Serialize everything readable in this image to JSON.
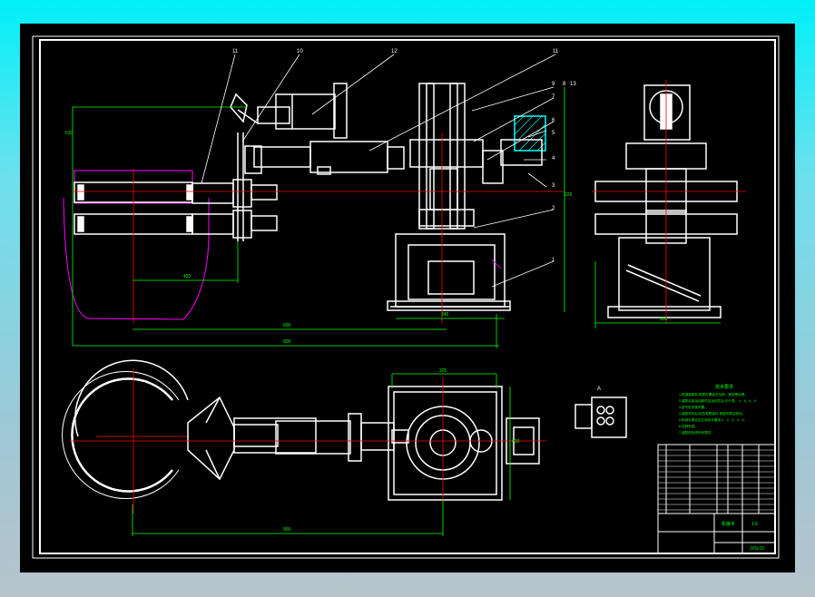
{
  "view": {
    "background_gradient": [
      "#00f0f8",
      "#b8c4cc"
    ],
    "canvas_color": "#000000"
  },
  "colors": {
    "outline": "#ffffff",
    "dimension": "#00ff00",
    "centerline": "#ff0000",
    "workpiece": "#ff00ff",
    "hatch": "#00ffff",
    "notes": "#00ff00",
    "leader": "#ffffff"
  },
  "callouts": [
    "11",
    "10",
    "12",
    "11",
    "9",
    "8",
    "13",
    "7",
    "6",
    "5",
    "4",
    "3",
    "2",
    "1"
  ],
  "dimensions": {
    "front_overall": "800",
    "front_span": "600",
    "front_height": "610",
    "front_reach": "420",
    "front_base": "340",
    "front_mid": "226",
    "side_width": "330",
    "top_overall": "900",
    "top_base": "325",
    "top_height": "820"
  },
  "detail_label": "A",
  "notes": {
    "title": "技术要求",
    "lines": [
      "1.机械装配前,各零件需经去毛刺、清洗等处理。",
      "2.装配后各运动部件应运动灵活,无卡滞。 4、6、8、9",
      "3.各气缸安装牢靠。",
      "4.装配完毕后,检查各联接件,紧固件是否松动。",
      "5.机械手调试应达到设计要求;1、2、3、4、5、",
      "6.控制系统。",
      "7.装配前检查所有零件。"
    ]
  },
  "title_block": {
    "drawing_name": "机械手",
    "scale": "1:5",
    "number": "JXS-01"
  }
}
